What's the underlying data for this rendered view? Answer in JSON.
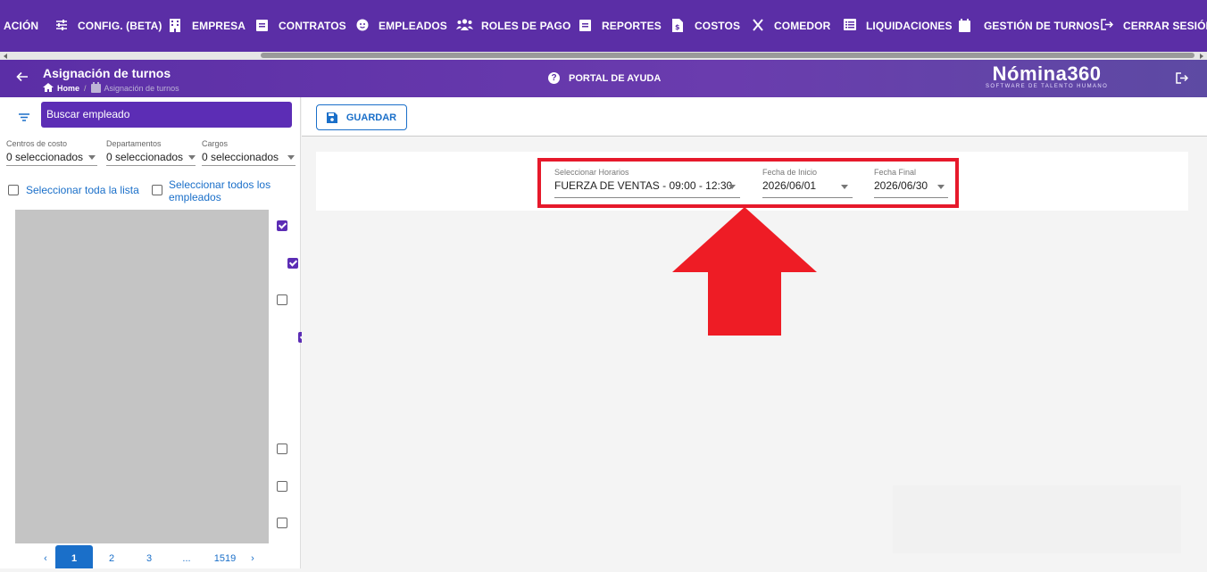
{
  "topnav": {
    "items": [
      {
        "label": "ACIÓN",
        "icon": "none"
      },
      {
        "label": "CONFIG. (BETA)",
        "icon": "sliders-icon"
      },
      {
        "label": "EMPRESA",
        "icon": "building-icon"
      },
      {
        "label": "CONTRATOS",
        "icon": "clipboard-icon"
      },
      {
        "label": "EMPLEADOS",
        "icon": "face-icon"
      },
      {
        "label": "ROLES DE PAGO",
        "icon": "people-icon"
      },
      {
        "label": "REPORTES",
        "icon": "clipboard-icon"
      },
      {
        "label": "COSTOS",
        "icon": "dollar-document-icon"
      },
      {
        "label": "COMEDOR",
        "icon": "utensils-icon"
      },
      {
        "label": "LIQUIDACIONES",
        "icon": "list-icon"
      },
      {
        "label": "GESTIÓN DE TURNOS",
        "icon": "calendar-icon"
      },
      {
        "label": "CERRAR SESIÓN",
        "icon": "logout-icon"
      }
    ]
  },
  "header": {
    "title": "Asignación de turnos",
    "breadcrumb_home": "Home",
    "breadcrumb_sep": "/",
    "breadcrumb_current": "Asignación de turnos",
    "help_label": "PORTAL DE AYUDA",
    "logo_name": "Nómina360",
    "logo_tagline": "SOFTWARE DE TALENTO HUMANO"
  },
  "sidebar": {
    "search_placeholder": "Buscar empleado",
    "filters": [
      {
        "label": "Centros de costo",
        "value": "0 seleccionados"
      },
      {
        "label": "Departamentos",
        "value": "0 seleccionados"
      },
      {
        "label": "Cargos",
        "value": "0 seleccionados"
      }
    ],
    "select_list_label": "Seleccionar toda la lista",
    "select_all_label": "Seleccionar todos los empleados",
    "row_checks": [
      true,
      true,
      false,
      true,
      true,
      true,
      false,
      false,
      false
    ],
    "pagination": {
      "prev": "‹",
      "pages": [
        "1",
        "2",
        "3",
        "...",
        "1519"
      ],
      "active": "1",
      "next": "›"
    }
  },
  "toolbar": {
    "save_label": "GUARDAR"
  },
  "form": {
    "schedule": {
      "label": "Seleccionar Horarios",
      "value": "FUERZA DE VENTAS - 09:00 - 12:30"
    },
    "start_date": {
      "label": "Fecha de Inicio",
      "value": "2026/06/01"
    },
    "end_date": {
      "label": "Fecha Final",
      "value": "2026/06/30"
    }
  },
  "colors": {
    "nav": "#5b2ea6",
    "accent": "#5c2db5",
    "link": "#1a6fc9",
    "highlight": "#e6192b"
  }
}
